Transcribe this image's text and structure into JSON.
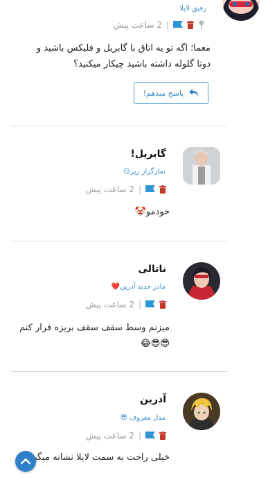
{
  "colors": {
    "accent": "#2f80c8",
    "trash": "#c0392b",
    "meta_text": "#9a9a9a"
  },
  "top_comment": {
    "role": "رفیق لایلا",
    "time": "2 ساعت پیش",
    "separator": "|",
    "text": "معما؛ اگه تو یه اتاق با گابریل و فلیکس باشید و دوتا گلوله داشته باشید چیکار میکنید؟",
    "reply_label": "پاسخ میدهم!",
    "icons": [
      "pin-icon",
      "trash-icon",
      "flag-icon"
    ]
  },
  "replies": [
    {
      "name": "گابریل!",
      "role": "نمازگزار ریر😏",
      "time": "2 ساعت پیش",
      "separator": "|",
      "text": "خودمو🤡"
    },
    {
      "name": "ناتالی",
      "role": "مادر جدید آدرین❤️",
      "time": "2 ساعت پیش",
      "separator": "|",
      "text": "میزنم وسط سقف سقف بریزه فرار کنم 😎😎😂"
    },
    {
      "name": "آدرین",
      "role": "مدل معروف 😎",
      "time": "2 ساعت پیش",
      "separator": "|",
      "text": "خیلی راحت به سمت لایلا نشانه میگیرم"
    }
  ],
  "scroll_top_icon": "chevron-up-icon"
}
